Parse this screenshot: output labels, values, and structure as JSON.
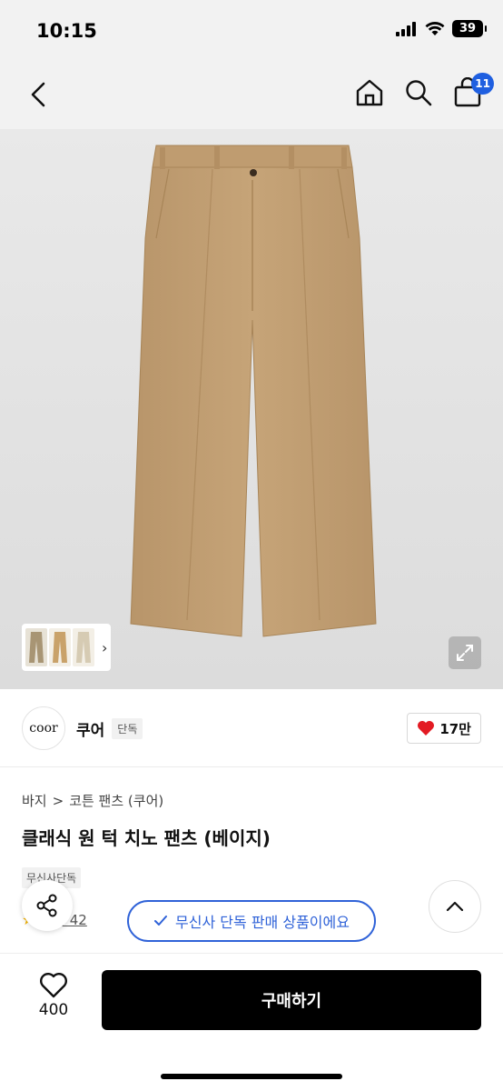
{
  "status": {
    "time": "10:15",
    "battery": "39"
  },
  "nav": {
    "cart_count": "11"
  },
  "brand": {
    "logo_text": "coor",
    "name": "쿠어",
    "tag": "단독",
    "likes": "17만"
  },
  "breadcrumb": {
    "category": "바지",
    "separator": ">",
    "subcategory": "코튼 팬츠 (쿠어)"
  },
  "product": {
    "title": "클래식 원 턱 치노 팬츠 (베이지)",
    "exclusive_tag": "무신사단독",
    "review_label": "후기 42"
  },
  "toast": {
    "text": "무신사 단독 판매 상품이에요"
  },
  "bottom": {
    "wish_count": "400",
    "buy_label": "구매하기"
  },
  "colors": {
    "accent_blue": "#2f62d8",
    "badge_blue": "#1f5fe0",
    "heart_red": "#e31b23",
    "pants_beige": "#c4a175"
  }
}
